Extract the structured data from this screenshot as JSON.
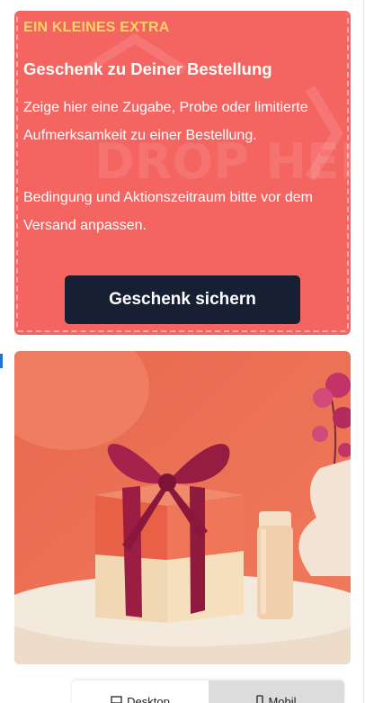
{
  "hero": {
    "eyebrow": "EIN KLEINES EXTRA",
    "title": "Geschenk zu Deiner Bestellung",
    "description": "Zeige hier eine Zugabe, Probe oder limitierte Aufmerksamkeit zu einer Bestellung.",
    "note": "Bedingung und Aktionszeitraum bitte vor dem Versand anpassen.",
    "cta_label": "Geschenk sichern",
    "watermark": "DROP HERE"
  },
  "preview_toggle": {
    "desktop_label": "Desktop",
    "mobile_label": "Mobil"
  },
  "colors": {
    "hero_bg": "#f46461",
    "eyebrow": "#ffd36a",
    "cta_bg": "#172032",
    "ribbon": "#9c1d44"
  },
  "icons": {
    "desktop": "monitor-icon",
    "mobile": "phone-icon",
    "watermark": "drop-zone-watermark"
  }
}
